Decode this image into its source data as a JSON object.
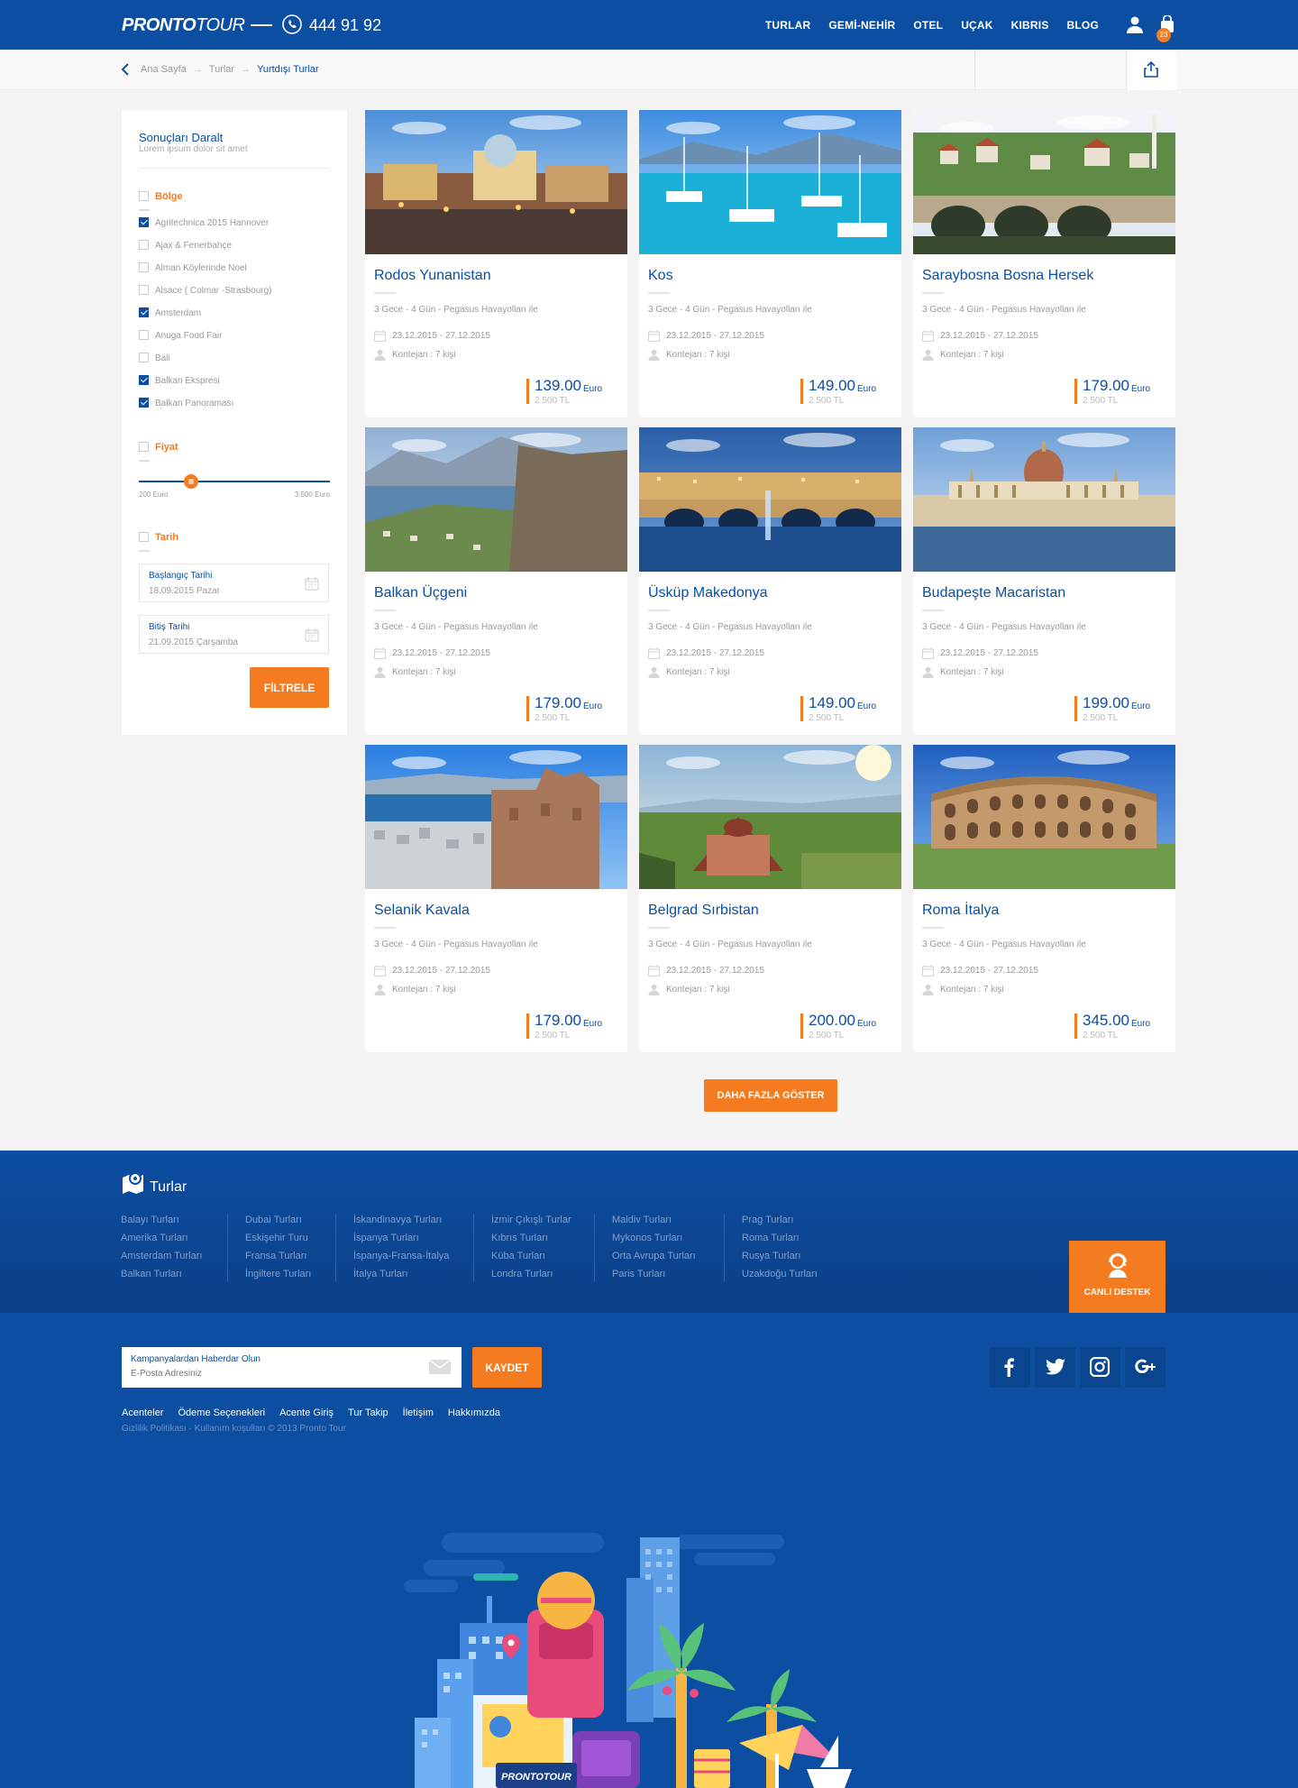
{
  "header": {
    "logo_brand": "PRONTO",
    "logo_tour": "TOUR",
    "phone": "444 91 92",
    "nav": [
      "TURLAR",
      "GEMİ-NEHİR",
      "OTEL",
      "UÇAK",
      "KIBRIS",
      "BLOG"
    ],
    "cart_count": "23"
  },
  "breadcrumb": [
    "Ana Sayfa",
    "Turlar",
    "Yurtdışı Turlar"
  ],
  "sidebar": {
    "title": "Sonuçları Daralt",
    "subtitle": "Lorem ipsum dolor sit amet",
    "region_label": "Bölge",
    "regions": [
      {
        "label": "Agritechnica 2015 Hannover",
        "checked": true
      },
      {
        "label": "Ajax & Fenerbahçe",
        "checked": false
      },
      {
        "label": "Alman Köylerinde Noel",
        "checked": false
      },
      {
        "label": "Alsace ( Colmar -Strasbourg)",
        "checked": false
      },
      {
        "label": "Amsterdam",
        "checked": true
      },
      {
        "label": "Anuga Food Fair",
        "checked": false
      },
      {
        "label": "Bali",
        "checked": false
      },
      {
        "label": "Balkan Ekspresi",
        "checked": true
      },
      {
        "label": "Balkan Panoraması",
        "checked": true
      }
    ],
    "price_label": "Fiyat",
    "price_min": "200 Euro",
    "price_max": "3.500 Euro",
    "date_label": "Tarih",
    "start_label": "Başlangıç Tarihi",
    "start_value": "18.09.2015 Pazar",
    "end_label": "Bitiş Tarihi",
    "end_value": "21.09.2015 Çarşamba",
    "filter_button": "FİLTRELE"
  },
  "tours": [
    {
      "title": "Rodos Yunanistan",
      "desc": "3 Gece - 4 Gün - Pegasus Havayolları ile",
      "dates": "23.12.2015 - 27.12.2015",
      "capacity": "Kontejan : 7 kişi",
      "price": "139.00",
      "currency": "Euro",
      "price_tl": "2.500 TL"
    },
    {
      "title": "Kos",
      "desc": "3 Gece - 4 Gün - Pegasus Havayolları ile",
      "dates": "23.12.2015 - 27.12.2015",
      "capacity": "Kontejan : 7 kişi",
      "price": "149.00",
      "currency": "Euro",
      "price_tl": "2.500 TL"
    },
    {
      "title": "Saraybosna Bosna Hersek",
      "desc": "3 Gece - 4 Gün - Pegasus Havayolları ile",
      "dates": "23.12.2015 - 27.12.2015",
      "capacity": "Kontejan : 7 kişi",
      "price": "179.00",
      "currency": "Euro",
      "price_tl": "2.500 TL"
    },
    {
      "title": "Balkan Üçgeni",
      "desc": "3 Gece - 4 Gün - Pegasus Havayolları ile",
      "dates": "23.12.2015 - 27.12.2015",
      "capacity": "Kontejan : 7 kişi",
      "price": "179.00",
      "currency": "Euro",
      "price_tl": "2.500 TL"
    },
    {
      "title": "Üsküp Makedonya",
      "desc": "3 Gece - 4 Gün - Pegasus Havayolları ile",
      "dates": "23.12.2015 - 27.12.2015",
      "capacity": "Kontejan : 7 kişi",
      "price": "149.00",
      "currency": "Euro",
      "price_tl": "2.500 TL"
    },
    {
      "title": "Budapeşte Macaristan",
      "desc": "3 Gece - 4 Gün - Pegasus Havayolları ile",
      "dates": "23.12.2015 - 27.12.2015",
      "capacity": "Kontejan : 7 kişi",
      "price": "199.00",
      "currency": "Euro",
      "price_tl": "2.500 TL"
    },
    {
      "title": "Selanik Kavala",
      "desc": "3 Gece - 4 Gün - Pegasus Havayolları ile",
      "dates": "23.12.2015 - 27.12.2015",
      "capacity": "Kontejan : 7 kişi",
      "price": "179.00",
      "currency": "Euro",
      "price_tl": "2.500 TL"
    },
    {
      "title": "Belgrad Sırbistan",
      "desc": "3 Gece - 4 Gün - Pegasus Havayolları ile",
      "dates": "23.12.2015 - 27.12.2015",
      "capacity": "Kontejan : 7 kişi",
      "price": "200.00",
      "currency": "Euro",
      "price_tl": "2.500 TL"
    },
    {
      "title": "Roma İtalya",
      "desc": "3 Gece - 4 Gün - Pegasus Havayolları ile",
      "dates": "23.12.2015 - 27.12.2015",
      "capacity": "Kontejan : 7 kişi",
      "price": "345.00",
      "currency": "Euro",
      "price_tl": "2.500 TL"
    }
  ],
  "more_button": "DAHA FAZLA GÖSTER",
  "footer": {
    "tours_title": "Turlar",
    "tour_columns": [
      [
        "Balayı Turları",
        "Amerika Turları",
        "Amsterdam Turları",
        "Balkan Turları"
      ],
      [
        "Dubai Turları",
        "Eskişehir Turu",
        "Fransa Turları",
        "İngiltere Turları"
      ],
      [
        "İskandinavya Turları",
        "İspanya Turları",
        "İspanya-Fransa-İtalya",
        "İtalya Turları"
      ],
      [
        "İzmir Çıkışlı Turlar",
        "Kıbrıs Turları",
        "Küba Turları",
        "Londra Turları"
      ],
      [
        "Maldiv Turları",
        "Mykonos Turları",
        "Orta Avrupa Turları",
        "Paris Turları"
      ],
      [
        "Prag Turları",
        "Roma Turları",
        "Rusya Turları",
        "Uzakdoğu Turları"
      ]
    ],
    "live_support": "CANLI DESTEK",
    "newsletter_label": "Kampanyalardan Haberdar Olun",
    "newsletter_placeholder": "E-Posta Adresiniz",
    "save_button": "KAYDET",
    "links": [
      "Acenteler",
      "Ödeme Seçenekleri",
      "Acente Giriş",
      "Tur Takip",
      "İletişim",
      "Hakkımızda"
    ],
    "legal": "Gizlilik Politikası · Kullanım koşulları  ©  2013 Pronto Tour",
    "illustration_logo": "PRONTOTOUR"
  },
  "colors": {
    "primary": "#0b4ea2",
    "accent": "#f47b20"
  }
}
